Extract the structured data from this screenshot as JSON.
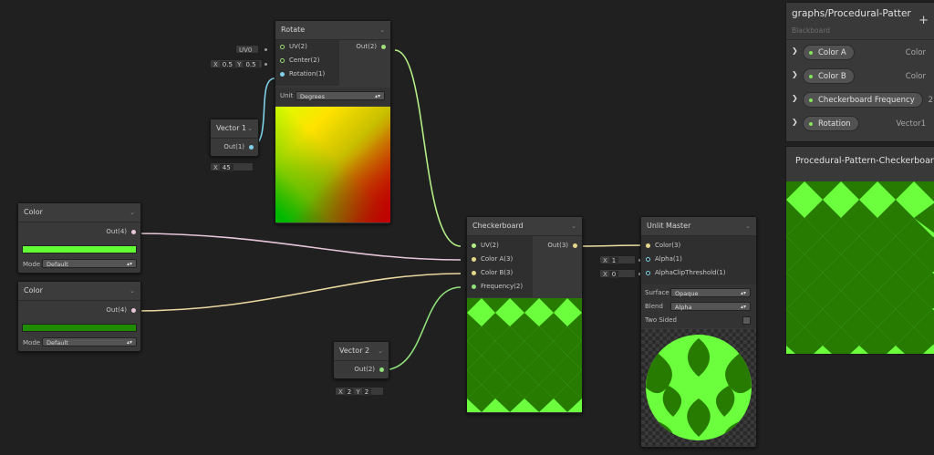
{
  "colors": {
    "light_green": "#6bff3d",
    "dark_green": "#267b00",
    "wire_uv": "#c8f08c",
    "wire_float": "#8fe07a",
    "wire_color": "#e0c6d6"
  },
  "rotate_node": {
    "title": "Rotate",
    "inputs": [
      "UV(2)",
      "Center(2)",
      "Rotation(1)"
    ],
    "output": "Out(2)",
    "unit_label": "Unit",
    "unit_value": "Degrees",
    "uv_field": "UV0",
    "center_x_label": "X",
    "center_x": "0.5",
    "center_y_label": "Y",
    "center_y": "0.5"
  },
  "vector1_node": {
    "title": "Vector 1",
    "output": "Out(1)",
    "x_label": "X",
    "x_value": "45"
  },
  "color_node_1": {
    "title": "Color",
    "output": "Out(4)",
    "swatch": "#63ff35",
    "mode_label": "Mode",
    "mode_value": "Default"
  },
  "color_node_2": {
    "title": "Color",
    "output": "Out(4)",
    "swatch": "#1f8c00",
    "mode_label": "Mode",
    "mode_value": "Default"
  },
  "vector2_node": {
    "title": "Vector 2",
    "output": "Out(2)",
    "x_label": "X",
    "x_value": "2",
    "y_label": "Y",
    "y_value": "2"
  },
  "checkerboard_node": {
    "title": "Checkerboard",
    "inputs": [
      "UV(2)",
      "Color A(3)",
      "Color B(3)",
      "Frequency(2)"
    ],
    "output": "Out(3)"
  },
  "unlit_node": {
    "title": "Unlit Master",
    "inputs": [
      "Color(3)",
      "Alpha(1)",
      "AlphaClipThreshold(1)"
    ],
    "alpha_x_label": "X",
    "alpha_x": "1",
    "clip_x_label": "X",
    "clip_x": "0",
    "surface_label": "Surface",
    "surface_value": "Opaque",
    "blend_label": "Blend",
    "blend_value": "Alpha",
    "two_sided_label": "Two Sided"
  },
  "blackboard": {
    "title": "graphs/Procedural-Patter",
    "subtitle": "Blackboard",
    "add_label": "+",
    "properties": [
      {
        "name": "Color A",
        "type": "Color"
      },
      {
        "name": "Color B",
        "type": "Color"
      },
      {
        "name": "Checkerboard Frequency",
        "type": "2"
      },
      {
        "name": "Rotation",
        "type": "Vector1"
      }
    ]
  },
  "main_preview": {
    "title": "Procedural-Pattern-Checkerboar"
  }
}
